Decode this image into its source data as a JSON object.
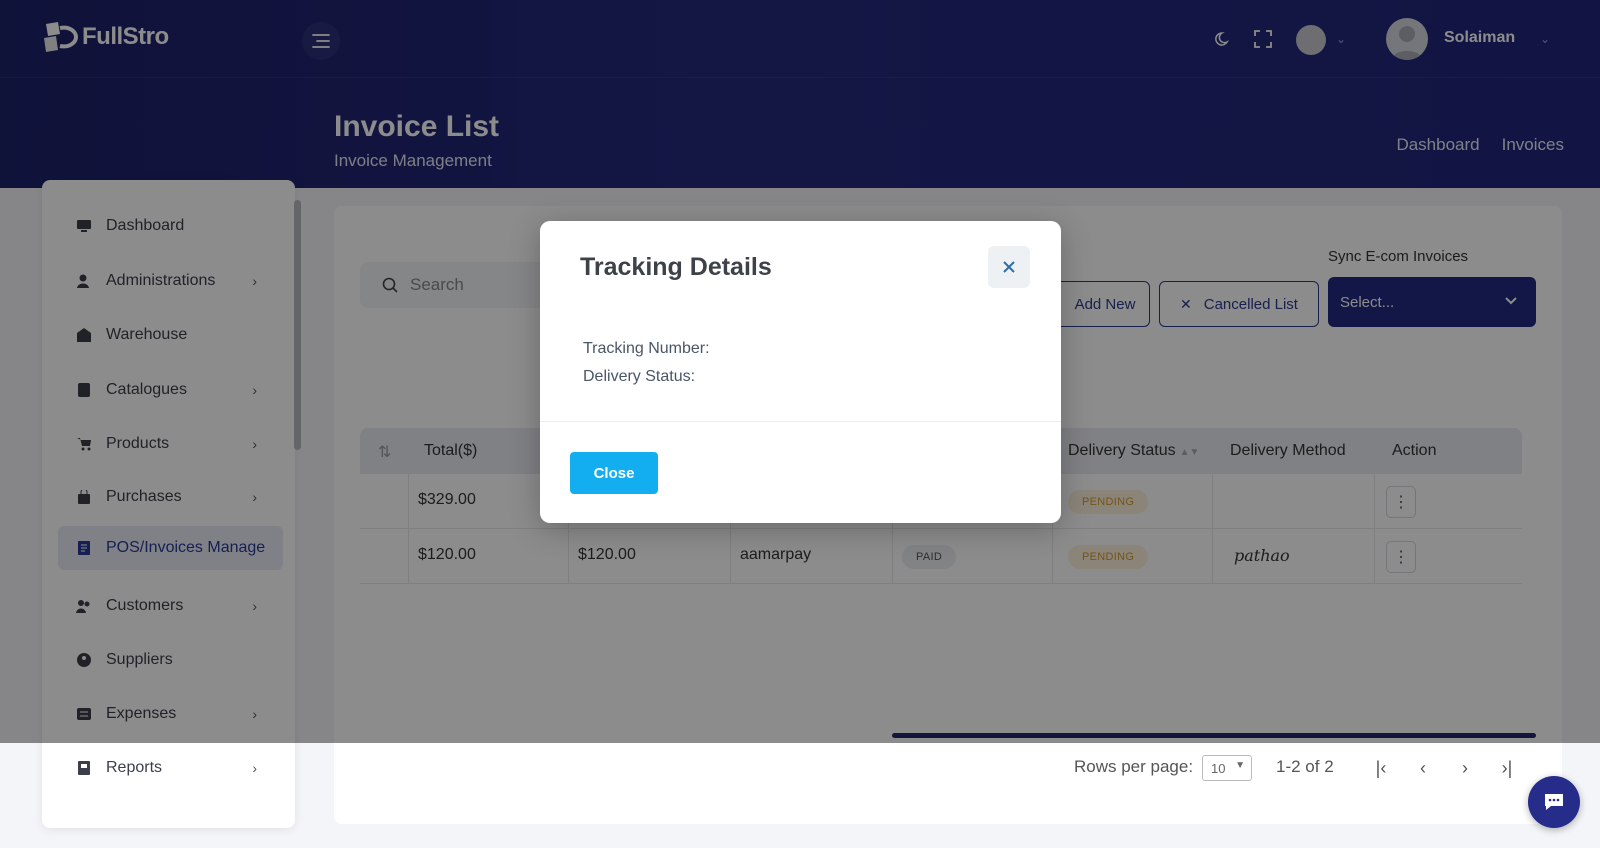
{
  "app": {
    "logo_text": "FullStro",
    "user_name": "Solaiman"
  },
  "page": {
    "title": "Invoice List",
    "subtitle": "Invoice Management",
    "breadcrumbs": [
      "Dashboard",
      "Invoices"
    ]
  },
  "sidebar": {
    "items": [
      {
        "label": "Dashboard",
        "icon": "monitor-icon",
        "chevron": false
      },
      {
        "label": "Administrations",
        "icon": "user-admin-icon",
        "chevron": true
      },
      {
        "label": "Warehouse",
        "icon": "warehouse-icon",
        "chevron": false
      },
      {
        "label": "Catalogues",
        "icon": "catalogue-icon",
        "chevron": true
      },
      {
        "label": "Products",
        "icon": "cart-icon",
        "chevron": true
      },
      {
        "label": "Purchases",
        "icon": "bag-icon",
        "chevron": true
      },
      {
        "label": "POS/Invoices Manage",
        "icon": "invoice-icon",
        "chevron": false,
        "active": true
      },
      {
        "label": "Customers",
        "icon": "customers-icon",
        "chevron": true
      },
      {
        "label": "Suppliers",
        "icon": "supplier-icon",
        "chevron": false
      },
      {
        "label": "Expenses",
        "icon": "expenses-icon",
        "chevron": true
      },
      {
        "label": "Reports",
        "icon": "report-icon",
        "chevron": true
      }
    ]
  },
  "toolbar": {
    "search_placeholder": "Search",
    "add_new": "Add New",
    "cancelled_list": "Cancelled List",
    "sync_label": "Sync E-com Invoices",
    "sync_value": "Select..."
  },
  "table": {
    "columns": [
      "Total($)",
      "Delivery Status",
      "Delivery Method",
      "Action"
    ],
    "rows": [
      {
        "total": "$329.00",
        "paid_amount": "",
        "method": "",
        "payment": "",
        "delivery_status": "PENDING",
        "delivery_method": ""
      },
      {
        "total": "$120.00",
        "paid_amount": "$120.00",
        "method": "aamarpay",
        "payment": "PAID",
        "delivery_status": "PENDING",
        "delivery_method": "pathao"
      }
    ]
  },
  "pagination": {
    "rows_per_page_label": "Rows per page:",
    "rows_per_page": "10",
    "range": "1-2 of 2"
  },
  "modal": {
    "title": "Tracking Details",
    "tracking_label": "Tracking Number:",
    "delivery_label": "Delivery Status:",
    "close_label": "Close"
  },
  "colors": {
    "header": "#22267a",
    "accent": "#13aef0",
    "primary": "#222a82",
    "pending": "#d49a2c"
  }
}
